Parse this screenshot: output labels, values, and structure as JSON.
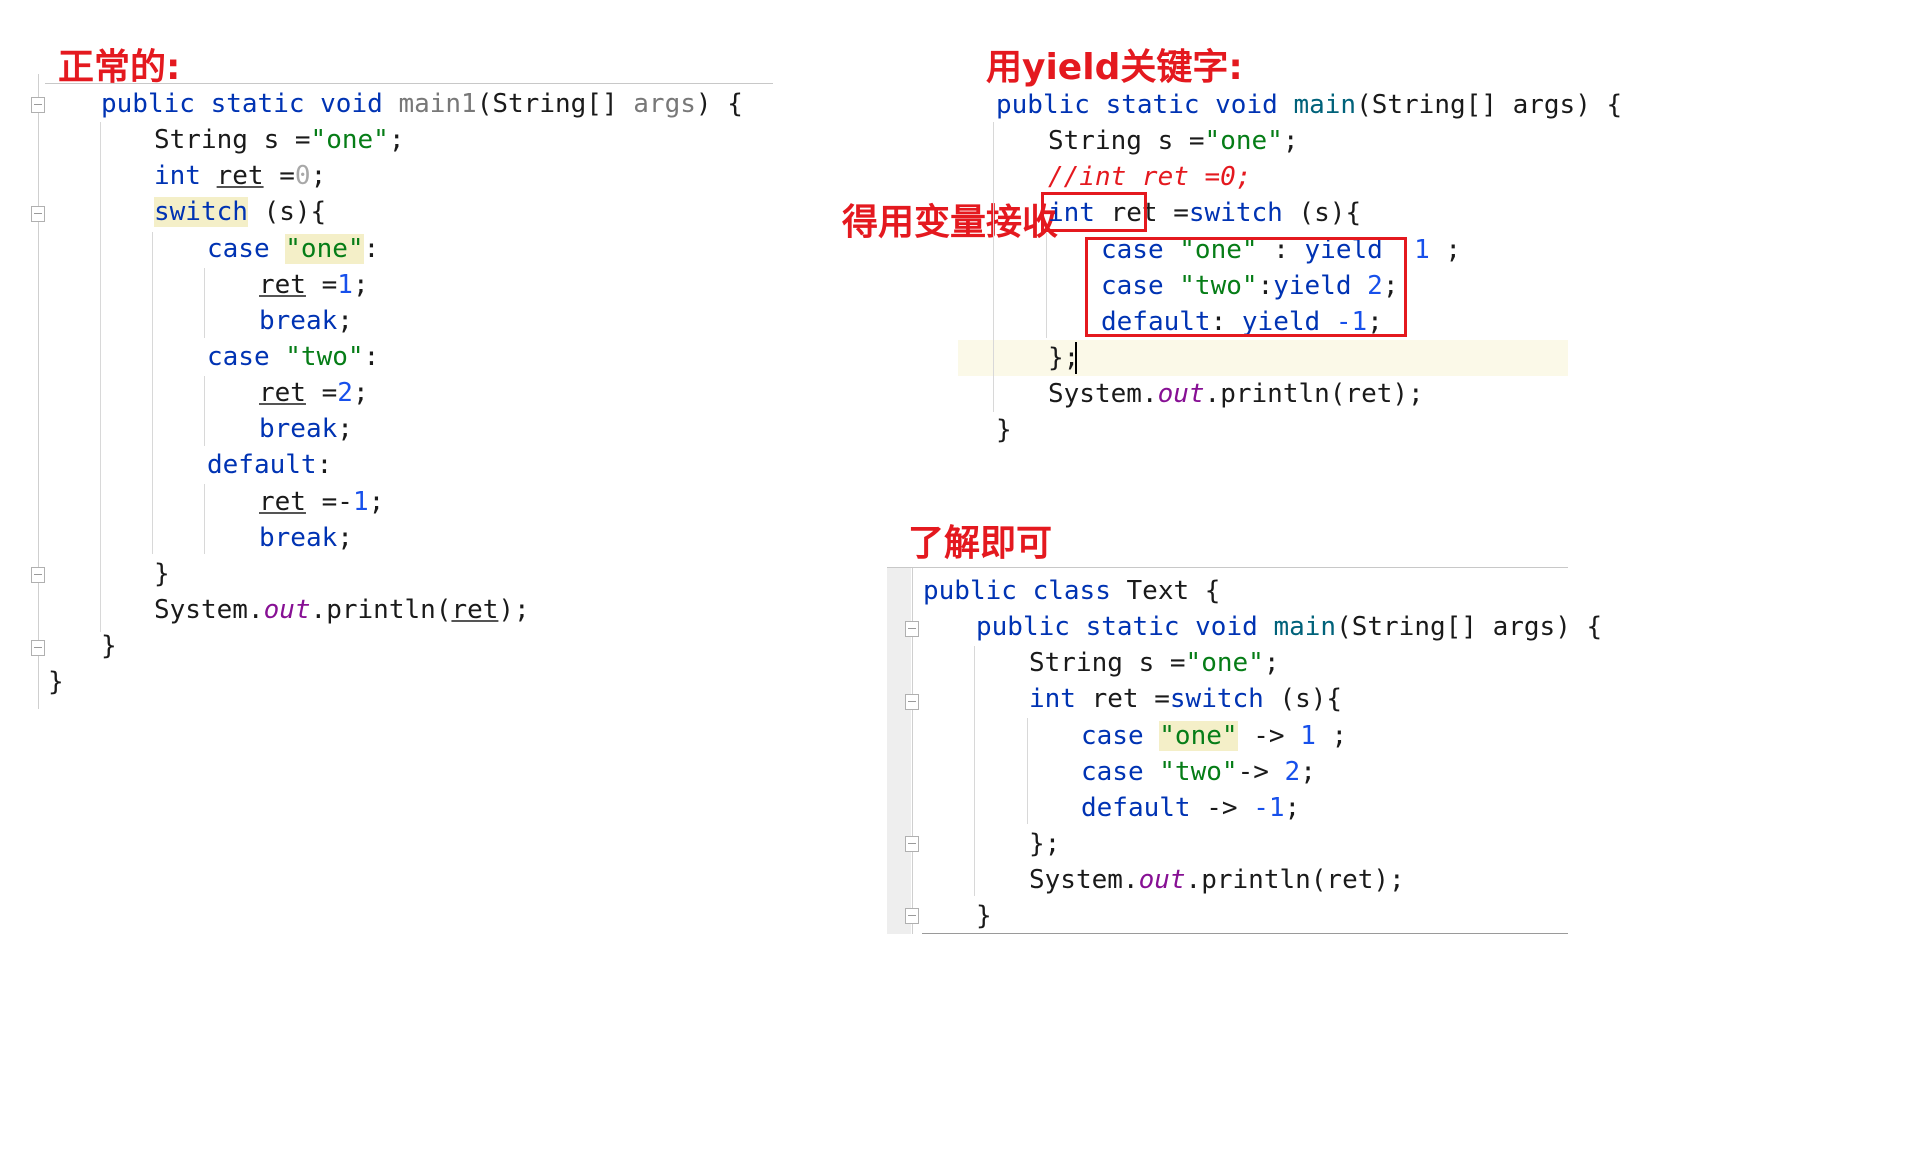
{
  "titles": {
    "left": "正常的:",
    "right_top": "用yield关键字:",
    "annotation": "得用变量接收",
    "right_bottom": "了解即可"
  },
  "left_code": {
    "sig_public": "public",
    "sig_static": "static",
    "sig_void": "void",
    "sig_name": "main1",
    "sig_params_open": "(String[] ",
    "sig_args": "args",
    "sig_close": ") {",
    "l2": "String s =",
    "l2_str": "\"one\"",
    "l2_end": ";",
    "l3_kw": "int",
    "l3_var": "ret",
    "l3_eq": " =",
    "l3_num": "0",
    "l3_end": ";",
    "l4_kw": "switch",
    "l4_rest": " (s){",
    "l5_kw": "case",
    "l5_str": "\"one\"",
    "l5_end": ":",
    "l6_var": "ret",
    "l6_eq": " =",
    "l6_num": "1",
    "l6_end": ";",
    "l7_kw": "break",
    "l7_end": ";",
    "l8_kw": "case",
    "l8_str": "\"two\"",
    "l8_end": ":",
    "l9_var": "ret",
    "l9_eq": " =",
    "l9_num": "2",
    "l9_end": ";",
    "l10_kw": "break",
    "l10_end": ";",
    "l11_kw": "default",
    "l11_end": ":",
    "l12_var": "ret",
    "l12_eq": " =-",
    "l12_num": "1",
    "l12_end": ";",
    "l13_kw": "break",
    "l13_end": ";",
    "l14": "}",
    "l15_a": "System.",
    "l15_field": "out",
    "l15_b": ".println(",
    "l15_var": "ret",
    "l15_c": ");",
    "l16": "}",
    "l17": "}"
  },
  "yield_code": {
    "sig_public": "public",
    "sig_static": "static",
    "sig_void": "void",
    "sig_name": "main",
    "sig_rest": "(String[] args) {",
    "l2": "String s =",
    "l2_str": "\"one\"",
    "l2_end": ";",
    "l3_comment": "//int ret =0;",
    "l4_kw": "int",
    "l4_var": " ret",
    "l4_eq": " =",
    "l4_kw2": "switch",
    "l4_rest": " (s){",
    "l5_kw": "case",
    "l5_str": "\"one\"",
    "l5_mid": " : ",
    "l5_kw2": "yield",
    "l5_num": "1",
    "l5_end": " ;",
    "l6_kw": "case",
    "l6_str": "\"two\"",
    "l6_mid": ":",
    "l6_kw2": "yield",
    "l6_num": "2",
    "l6_end": ";",
    "l7_kw": "default",
    "l7_mid": ": ",
    "l7_kw2": "yield",
    "l7_num": "-1",
    "l7_end": ";",
    "l8": "};",
    "l9_a": "System.",
    "l9_field": "out",
    "l9_b": ".println(ret);",
    "l10": "}"
  },
  "arrow_code": {
    "l0_public": "public",
    "l0_class": "class",
    "l0_rest": " Text {",
    "sig_public": "public",
    "sig_static": "static",
    "sig_void": "void",
    "sig_name": "main",
    "sig_rest": "(String[] args) {",
    "l2": "String s =",
    "l2_str": "\"one\"",
    "l2_end": ";",
    "l3_kw": "int",
    "l3_mid": " ret =",
    "l3_kw2": "switch",
    "l3_rest": " (s){",
    "l4_kw": "case",
    "l4_str": "\"one\"",
    "l4_mid": " -> ",
    "l4_num": "1",
    "l4_end": " ;",
    "l5_kw": "case",
    "l5_str": "\"two\"",
    "l5_mid": "-> ",
    "l5_num": "2",
    "l5_end": ";",
    "l6_kw": "default",
    "l6_mid": " -> ",
    "l6_num": "-1",
    "l6_end": ";",
    "l7": "};",
    "l8_a": "System.",
    "l8_field": "out",
    "l8_b": ".println(ret);",
    "l9": "}"
  },
  "colors": {
    "keyword": "#0033b3",
    "string": "#067d17",
    "number": "#1750eb",
    "field": "#871094",
    "annotation_red": "#e4191f",
    "highlight": "#f4efc8"
  }
}
